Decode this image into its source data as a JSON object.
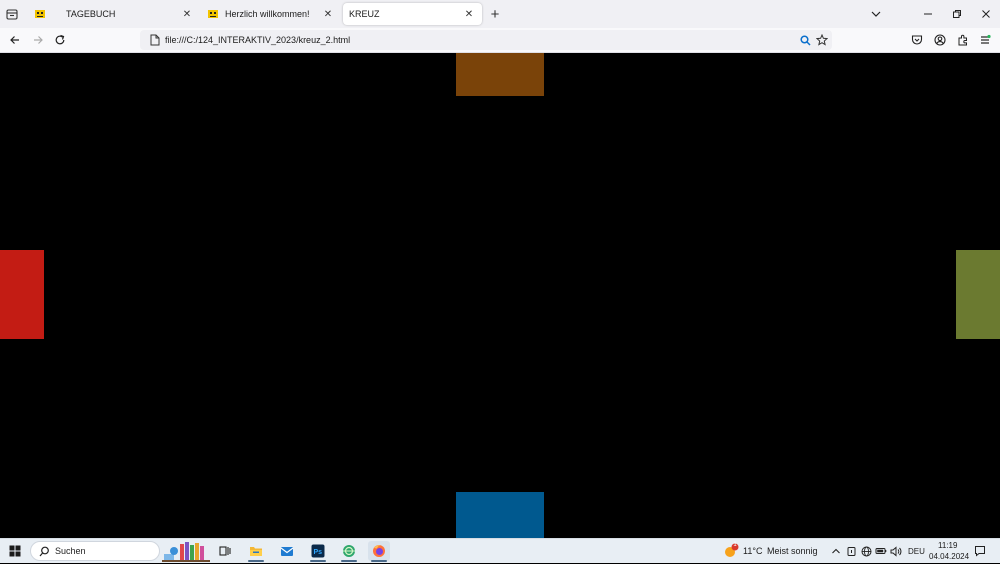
{
  "browser": {
    "tabs": [
      {
        "label": "TAGEBUCH",
        "favicon": "yellow-robot-icon",
        "active": false
      },
      {
        "label": "Herzlich willkommen!",
        "favicon": "yellow-robot-icon",
        "active": false
      },
      {
        "label": "KREUZ",
        "favicon": "none",
        "active": true
      }
    ],
    "url": "file:///C:/124_INTERAKTIV_2023/kreuz_2.html"
  },
  "page": {
    "background": "#000000",
    "squares": [
      {
        "name": "top",
        "color": "#7a4309"
      },
      {
        "name": "left",
        "color": "#c31c14"
      },
      {
        "name": "right",
        "color": "#6b7a30"
      },
      {
        "name": "bottom",
        "color": "#00598f"
      }
    ]
  },
  "taskbar": {
    "search_label": "Suchen",
    "weather": {
      "temp": "11°C",
      "condition": "Meist sonnig",
      "badge": "1"
    },
    "language": "DEU",
    "time": "11:19",
    "date": "04.04.2024"
  }
}
